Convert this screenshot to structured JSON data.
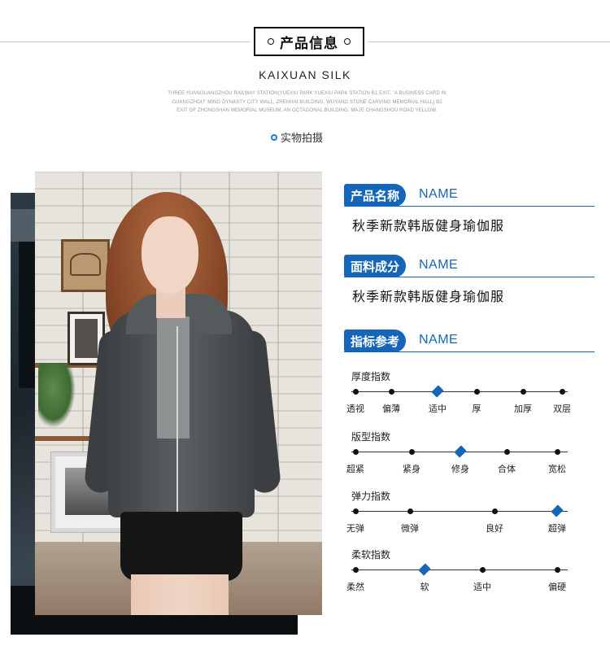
{
  "header": {
    "title": "产品信息",
    "subtitle": "KAIXUAN SILK",
    "description": "THREE YUANGUANGZHOU RAILWAY STATION(YUEXIU PARK:YUEXIU PARK STATION B1 EXIT, \"A BUSINESS CARD IN GUANGZHOU\" MING DYNASTY CITY WALL, ZHENHAI BUILDING, WUYANG STONE CARVING MEMORIAL HALL) B2 EXIT OF ZHONGSHAN MEMORIAL MUSEUM, AN OCTAGONAL BUILDING, MAJE CHANGSHOU ROAD YELLOW:",
    "real_shot_label": "实物拍摄"
  },
  "product": {
    "name_tag": "产品名称",
    "name_tag_en": "NAME",
    "name_value": "秋季新款韩版健身瑜伽服",
    "fabric_tag": "面料成分",
    "fabric_tag_en": "NAME",
    "fabric_value": "秋季新款韩版健身瑜伽服",
    "index_tag": "指标参考",
    "index_tag_en": "NAME"
  },
  "scales": [
    {
      "title": "厚度指数",
      "labels": [
        "透视",
        "偏薄",
        "适中",
        "厚",
        "加厚",
        "双层"
      ],
      "marks": 6,
      "selected": 2
    },
    {
      "title": "版型指数",
      "labels": [
        "超紧",
        "紧身",
        "修身",
        "合体",
        "宽松"
      ],
      "marks": 5,
      "selected": 2
    },
    {
      "title": "弹力指数",
      "labels": [
        "无弹",
        "微弹",
        "良好",
        "超弹"
      ],
      "marks": 4,
      "selected": 3
    },
    {
      "title": "柔软指数",
      "labels": [
        "柔然",
        "软",
        "适中",
        "偏硬"
      ],
      "marks": 4,
      "selected": 1
    }
  ],
  "colors": {
    "accent": "#1566b8"
  }
}
